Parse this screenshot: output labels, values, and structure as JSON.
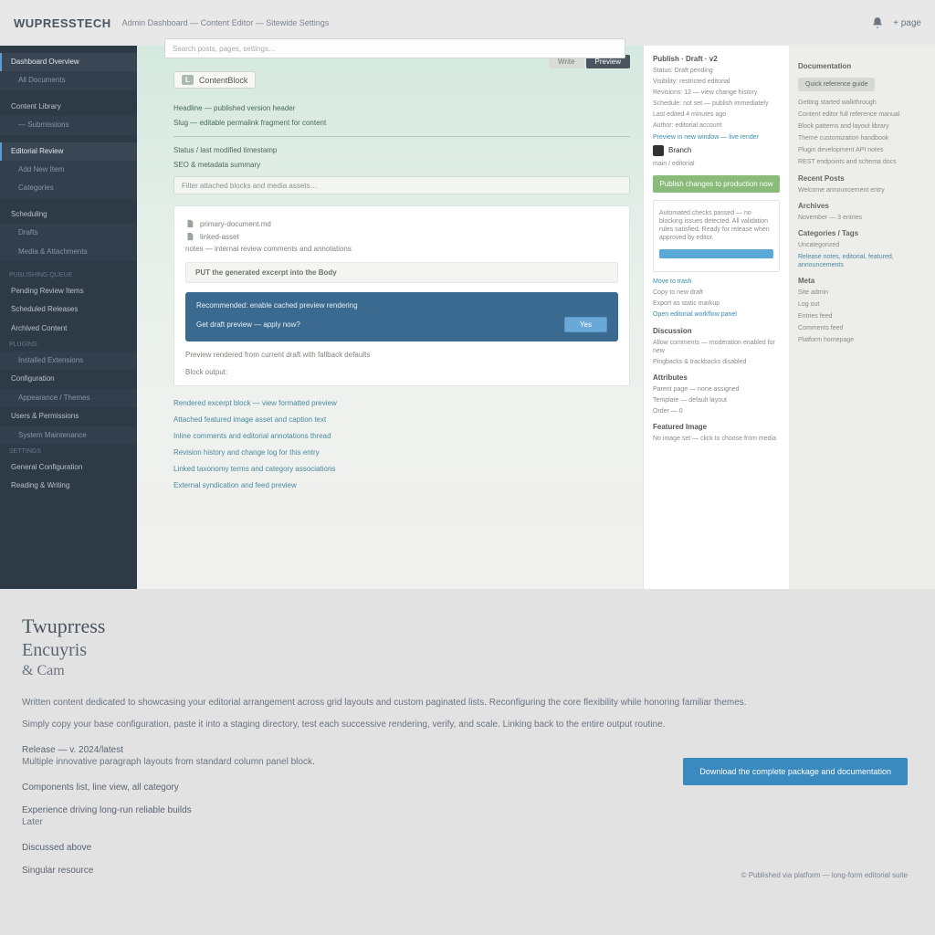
{
  "top": {
    "logo": "WUPRESSTECH",
    "crumb": "Admin Dashboard — Content Editor — Sitewide Settings",
    "right_icon": "bell",
    "right_text": "+ page"
  },
  "search": {
    "placeholder": "Search posts, pages, settings…"
  },
  "sidebar": {
    "items": [
      {
        "label": "Dashboard Overview",
        "active": true
      },
      {
        "label": "All Documents",
        "sub": true
      },
      {
        "label": "Content Library",
        "sub": false
      },
      {
        "label": "— Submissions",
        "sub": true
      },
      {
        "label": "Editorial Review",
        "active": false
      },
      {
        "label": "Add New Item",
        "sub": true
      },
      {
        "label": "Categories",
        "sub": true
      },
      {
        "label": "Scheduling",
        "sub": false
      },
      {
        "label": "Drafts",
        "sub": true
      },
      {
        "label": "Media & Attachments",
        "sub": true
      },
      {
        "label": "Publishing Queue",
        "group": true
      },
      {
        "label": "Pending Review Items",
        "sub": false
      },
      {
        "label": "Scheduled Releases",
        "sub": false
      },
      {
        "label": "Archived Content",
        "sub": false
      },
      {
        "label": "Plugins",
        "group": true
      },
      {
        "label": "Installed Extensions",
        "sub": true
      },
      {
        "label": "Configuration",
        "sub": false
      },
      {
        "label": "Appearance / Themes",
        "sub": true
      },
      {
        "label": "Users & Permissions",
        "sub": false
      },
      {
        "label": "System Maintenance",
        "sub": true
      },
      {
        "label": "Settings",
        "group": true
      },
      {
        "label": "General Configuration",
        "sub": false
      },
      {
        "label": "Reading & Writing",
        "sub": false
      }
    ]
  },
  "main": {
    "tabs": [
      {
        "label": "Write",
        "active": false
      },
      {
        "label": "Preview",
        "active": true
      }
    ],
    "title_badge": "L",
    "title_text": "ContentBlock",
    "fields": [
      "Headline — published version header",
      "Slug — editable permalink fragment for content",
      "Status / last modified timestamp",
      "SEO & metadata summary"
    ],
    "search2": "Filter attached blocks and media assets…",
    "card": {
      "rows": [
        "primary-document.md",
        "linked-asset",
        "notes — internal review comments and annotations"
      ]
    },
    "strip": "PUT the generated excerpt into the Body",
    "blue": {
      "l1": "Recommended: enable cached preview rendering",
      "l2": "Get draft preview — apply now?",
      "btn": "Yes"
    },
    "par1": "Preview rendered from current draft with fallback defaults",
    "par2": "Block output:",
    "links": [
      "Rendered excerpt block — view formatted preview",
      "Attached featured image asset and caption text",
      "Inline comments and editorial annotations thread",
      "Revision history and change log for this entry",
      "Linked taxonomy terms and category associations",
      "External syndication and feed preview"
    ]
  },
  "panel": {
    "head1": "Publish · Draft · v2",
    "lines1": [
      "Status: Draft pending",
      "Visibility: restricted editorial",
      "Revisions: 12 — view change history",
      "Schedule: not set — publish immediately",
      "Last edited 4 minutes ago",
      "Author: editorial account"
    ],
    "review_link": "Preview in new window — live render",
    "logo": "Branch",
    "logo_sub": "main / editorial",
    "green_btn": "Publish changes to production now",
    "box_lines": [
      "Automated checks passed — no blocking issues detected. All validation rules satisfied. Ready for release when approved by editor."
    ],
    "blue_btn": " ",
    "mid_links": [
      "Move to trash",
      "Copy to new draft",
      "Export as static markup"
    ],
    "link1": "Open editorial workflow panel",
    "head2": "Discussion",
    "lines2": [
      "Allow comments — moderation enabled for new",
      "Pingbacks & trackbacks disabled"
    ],
    "head3": "Attributes",
    "lines3": [
      "Parent page — none assigned",
      "Template — default layout",
      "Order — 0"
    ],
    "head4": "Featured Image",
    "lines4": [
      "No image set — click to choose from media"
    ]
  },
  "right": {
    "head1": "Documentation",
    "grey_btn": "Quick reference guide",
    "lines1": [
      "Getting started walkthrough",
      "Content editor full reference manual",
      "Block patterns and layout library",
      "Theme customization handbook",
      "Plugin development API notes",
      "REST endpoints and schema docs"
    ],
    "head2": "Recent Posts",
    "lines2": [
      "Welcome announcement entry"
    ],
    "head3": "Archives",
    "lines3": [
      "November — 3 entries"
    ],
    "head4": "Categories / Tags",
    "lines4": [
      "Uncategorized",
      "Release notes, editorial, featured, announcements"
    ],
    "head5": "Meta",
    "lines5": [
      "Site admin",
      "Log out",
      "Entries feed",
      "Comments feed",
      "Platform homepage"
    ]
  },
  "lower": {
    "h1": "Twuprress",
    "h2": "Encuyris",
    "h3": "& Cam",
    "p1": "Written content dedicated to showcasing your editorial arrangement across grid layouts and custom paginated lists. Reconfiguring the core flexibility while honoring familiar themes.",
    "p2": "Simply copy your base configuration, paste it into a staging directory, test each successive rendering, verify, and scale. Linking back to the entire output routine.",
    "sec1": "Release — v. 2024/latest",
    "p3": "Multiple innovative paragraph layouts from standard column panel block.",
    "sec2": "Components list, line view, all category",
    "sec3": "Experience driving long-run reliable builds",
    "p4": "Later",
    "sec4": "Discussed above",
    "sec5": "Singular resource",
    "cta": "Download the complete package and documentation",
    "foot": "© Published via platform — long-form editorial suite"
  }
}
